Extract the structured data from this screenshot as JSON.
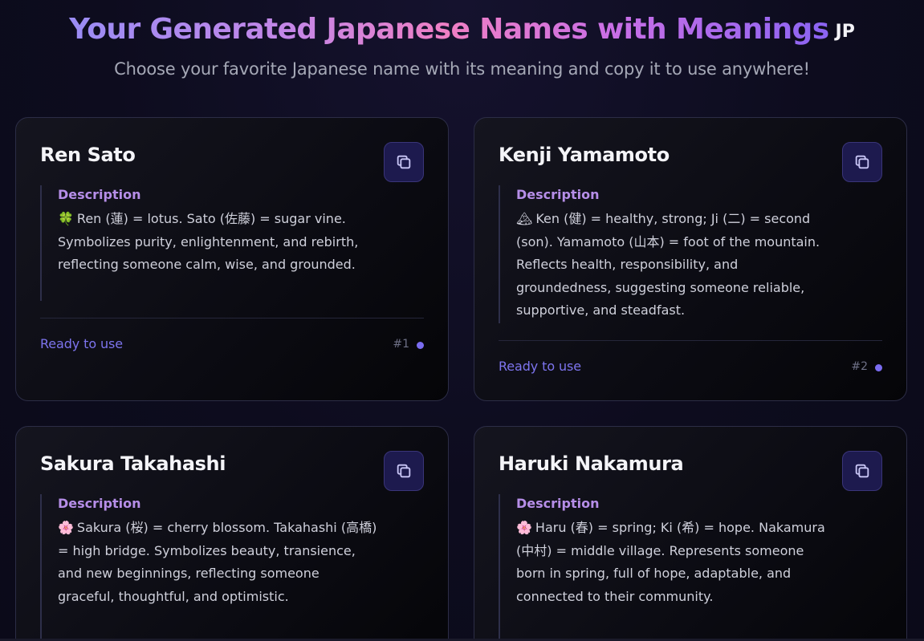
{
  "header": {
    "title": "Your Generated Japanese Names with Meanings",
    "badge": "JP",
    "subtitle": "Choose your favorite Japanese name with its meaning and copy it to use anywhere!"
  },
  "cards": [
    {
      "name": "Ren Sato",
      "description_label": "Description",
      "emoji": "🍀",
      "description": "Ren (蓮) = lotus. Sato (佐藤) = sugar vine. Symbolizes purity, enlightenment, and rebirth, reflecting someone calm, wise, and grounded.",
      "status": "Ready to use",
      "number": "#1"
    },
    {
      "name": "Kenji Yamamoto",
      "description_label": "Description",
      "emoji": "🏔",
      "description": "Ken (健) = healthy, strong; Ji (二) = second (son). Yamamoto (山本) = foot of the mountain. Reflects health, responsibility, and groundedness, suggesting someone reliable, supportive, and steadfast.",
      "status": "Ready to use",
      "number": "#2"
    },
    {
      "name": "Sakura Takahashi",
      "description_label": "Description",
      "emoji": "🌸",
      "description": "Sakura (桜) = cherry blossom. Takahashi (高橋) = high bridge. Symbolizes beauty, transience, and new beginnings, reflecting someone graceful, thoughtful, and optimistic."
    },
    {
      "name": "Haruki Nakamura",
      "description_label": "Description",
      "emoji": "🌸",
      "description": "Haru (春) = spring; Ki (希) = hope. Nakamura (中村) = middle village. Represents someone born in spring, full of hope, adaptable, and connected to their community."
    }
  ],
  "colors": {
    "accent": "#7d74ee",
    "label": "#b68ee8",
    "copy_button_bg": "#1d1a4e"
  },
  "icons": {
    "copy": "copy-icon",
    "status_dot": "status-dot"
  }
}
